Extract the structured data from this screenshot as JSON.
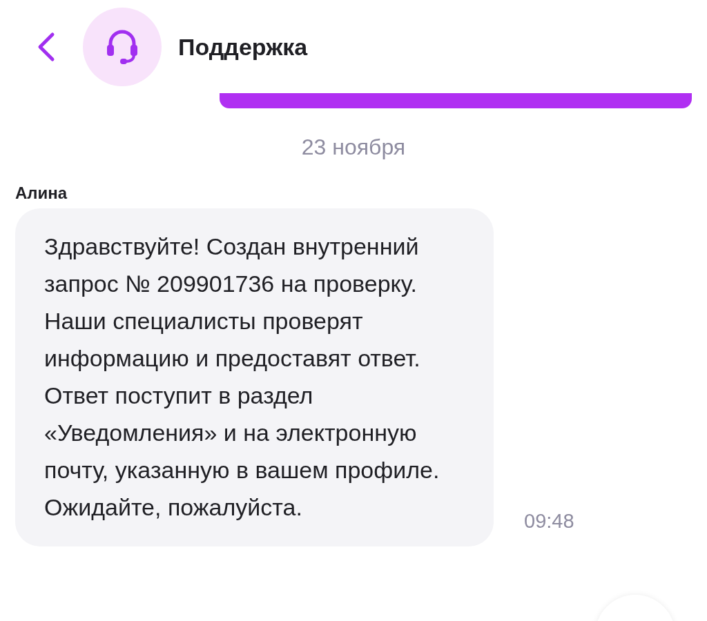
{
  "header": {
    "title": "Поддержка"
  },
  "date_separator": "23 ноября",
  "messages": [
    {
      "sender": "Алина",
      "text": "Здравствуйте! Создан внутренний запрос № 209901736 на проверку. Наши специалисты проверят информацию и предоставят ответ. Ответ поступит в раздел «Уведомления» и на электронную почту, указанную в вашем профиле. Ожидайте, пожалуйста.",
      "time": "09:48"
    }
  ]
}
